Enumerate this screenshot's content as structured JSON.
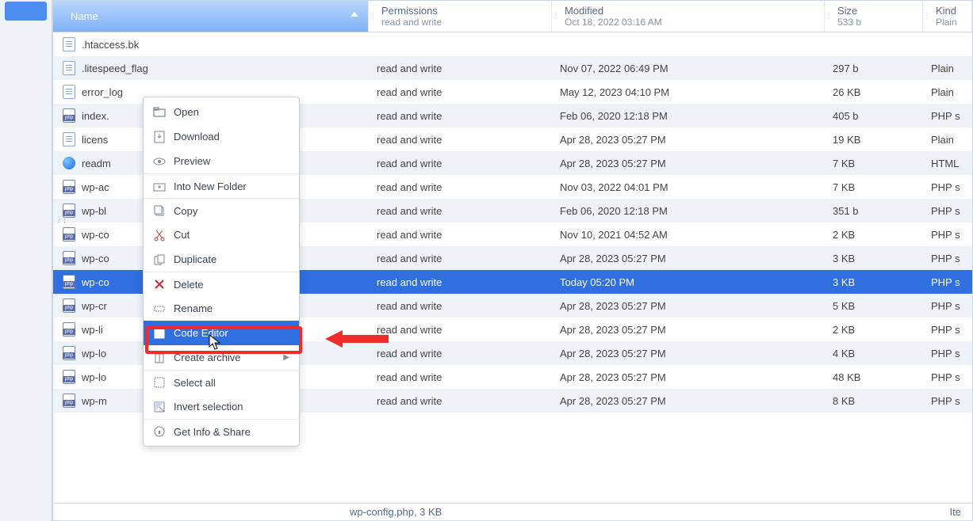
{
  "columns": {
    "name": "Name",
    "perm_l1": "Permissions",
    "perm_l2": "read and write",
    "mod_l1": "Modified",
    "mod_l2": "Oct 18, 2022 03:16 AM",
    "size_l1": "Size",
    "size_l2": "533 b",
    "kind_l1": "Kind",
    "kind_l2": "Plain"
  },
  "rows": [
    {
      "icon": "txt",
      "name": ".htaccess.bk",
      "perm": "",
      "mod": "",
      "size": "",
      "kind": ""
    },
    {
      "icon": "txt",
      "name": ".litespeed_flag",
      "perm": "read and write",
      "mod": "Nov 07, 2022 06:49 PM",
      "size": "297 b",
      "kind": "Plain"
    },
    {
      "icon": "txt",
      "name": "error_log",
      "perm": "read and write",
      "mod": "May 12, 2023 04:10 PM",
      "size": "26 KB",
      "kind": "Plain"
    },
    {
      "icon": "php",
      "name": "index.",
      "perm": "read and write",
      "mod": "Feb 06, 2020 12:18 PM",
      "size": "405 b",
      "kind": "PHP s"
    },
    {
      "icon": "txt",
      "name": "licens",
      "perm": "read and write",
      "mod": "Apr 28, 2023 05:27 PM",
      "size": "19 KB",
      "kind": "Plain"
    },
    {
      "icon": "html",
      "name": "readm",
      "perm": "read and write",
      "mod": "Apr 28, 2023 05:27 PM",
      "size": "7 KB",
      "kind": "HTML"
    },
    {
      "icon": "php",
      "name": "wp-ac",
      "perm": "read and write",
      "mod": "Nov 03, 2022 04:01 PM",
      "size": "7 KB",
      "kind": "PHP s"
    },
    {
      "icon": "php",
      "name": "wp-bl",
      "perm": "read and write",
      "mod": "Feb 06, 2020 12:18 PM",
      "size": "351 b",
      "kind": "PHP s"
    },
    {
      "icon": "php",
      "name": "wp-co",
      "perm": "read and write",
      "mod": "Nov 10, 2021 04:52 AM",
      "size": "2 KB",
      "kind": "PHP s"
    },
    {
      "icon": "php",
      "name": "wp-co",
      "perm": "read and write",
      "mod": "Apr 28, 2023 05:27 PM",
      "size": "3 KB",
      "kind": "PHP s"
    },
    {
      "icon": "php",
      "name": "wp-co",
      "perm": "read and write",
      "mod": "Today 05:20 PM",
      "size": "3 KB",
      "kind": "PHP s",
      "sel": true
    },
    {
      "icon": "php",
      "name": "wp-cr",
      "perm": "read and write",
      "mod": "Apr 28, 2023 05:27 PM",
      "size": "5 KB",
      "kind": "PHP s"
    },
    {
      "icon": "php",
      "name": "wp-li",
      "perm": "read and write",
      "mod": "Apr 28, 2023 05:27 PM",
      "size": "2 KB",
      "kind": "PHP s"
    },
    {
      "icon": "php",
      "name": "wp-lo",
      "perm": "read and write",
      "mod": "Apr 28, 2023 05:27 PM",
      "size": "4 KB",
      "kind": "PHP s"
    },
    {
      "icon": "php",
      "name": "wp-lo",
      "perm": "read and write",
      "mod": "Apr 28, 2023 05:27 PM",
      "size": "48 KB",
      "kind": "PHP s"
    },
    {
      "icon": "php",
      "name": "wp-m",
      "perm": "read and write",
      "mod": "Apr 28, 2023 05:27 PM",
      "size": "8 KB",
      "kind": "PHP s"
    }
  ],
  "status": {
    "left": "wp-config.php, 3 KB",
    "right": "Ite"
  },
  "menu": {
    "open": "Open",
    "download": "Download",
    "preview": "Preview",
    "into_folder": "Into New Folder",
    "copy": "Copy",
    "cut": "Cut",
    "duplicate": "Duplicate",
    "delete": "Delete",
    "rename": "Rename",
    "code_editor": "Code Editor",
    "create_archive": "Create archive",
    "select_all": "Select all",
    "invert": "Invert selection",
    "info": "Get Info & Share"
  }
}
